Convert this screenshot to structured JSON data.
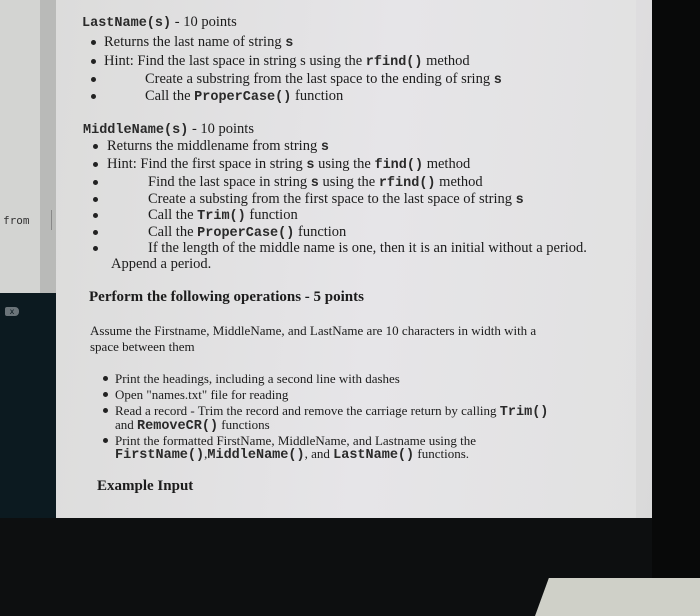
{
  "sidebar": {
    "from_label": "from",
    "close_icon": "x"
  },
  "lastname": {
    "heading": [
      {
        "t": "LastName(s)",
        "c": true
      },
      {
        "t": " - 10 points"
      }
    ],
    "items": [
      [
        {
          "t": "Returns the last name of string "
        },
        {
          "t": "s",
          "c": true
        }
      ],
      [
        {
          "t": "Hint:  Find the last space in string s using the "
        },
        {
          "t": "rfind()",
          "c": true
        },
        {
          "t": " method"
        }
      ],
      [
        {
          "t": "Create a substring from the last space to the ending of  sring "
        },
        {
          "t": "s",
          "c": true
        }
      ],
      [
        {
          "t": "Call the "
        },
        {
          "t": "ProperCase()",
          "c": true
        },
        {
          "t": " function"
        }
      ]
    ]
  },
  "middlename": {
    "heading": [
      {
        "t": "MiddleName(s)",
        "c": true
      },
      {
        "t": " - 10 points"
      }
    ],
    "items": [
      [
        {
          "t": "Returns the middlename from string "
        },
        {
          "t": "s",
          "c": true
        }
      ],
      [
        {
          "t": "Hint:  Find the first space in string "
        },
        {
          "t": "s",
          "c": true
        },
        {
          "t": " using the "
        },
        {
          "t": "find()",
          "c": true
        },
        {
          "t": "  method"
        }
      ],
      [
        {
          "t": "Find the last space in string "
        },
        {
          "t": "s",
          "c": true
        },
        {
          "t": " using the "
        },
        {
          "t": "rfind()",
          "c": true
        },
        {
          "t": " method"
        }
      ],
      [
        {
          "t": "Create a substing from the first space to the last space of string "
        },
        {
          "t": "s",
          "c": true
        }
      ],
      [
        {
          "t": "Call the "
        },
        {
          "t": "Trim()",
          "c": true
        },
        {
          "t": " function"
        }
      ],
      [
        {
          "t": "Call the "
        },
        {
          "t": "ProperCase()",
          "c": true
        },
        {
          "t": " function"
        }
      ],
      [
        {
          "t": "If the length of the middle name is one, then it is an initial without a period."
        }
      ]
    ],
    "continuation": "Append a period."
  },
  "operations": {
    "heading": "Perform the following operations - 5 points",
    "assume_line1": "Assume the Firstname, MiddleName, and LastName are 10 characters in width with a",
    "assume_line2": "space between them",
    "lines": [
      [
        {
          "t": "Print the headings, including a second line with dashes"
        }
      ],
      [
        {
          "t": "Open \"names.txt\" file for reading"
        }
      ],
      [
        {
          "t": "Read a record - Trim the record and remove the carriage return by calling "
        },
        {
          "t": "Trim()",
          "c": true
        }
      ],
      [
        {
          "t": "and "
        },
        {
          "t": "RemoveCR()",
          "c": true
        },
        {
          "t": " functions"
        }
      ],
      [
        {
          "t": "Print the formatted FirstName, MiddleName, and Lastname using the"
        }
      ],
      [
        {
          "t": "FirstName()",
          "c": true
        },
        {
          "t": ","
        },
        {
          "t": "MiddleName()",
          "c": true
        },
        {
          "t": ", and "
        },
        {
          "t": "LastName()",
          "c": true
        },
        {
          "t": " functions."
        }
      ]
    ]
  },
  "example": {
    "heading": "Example Input"
  }
}
